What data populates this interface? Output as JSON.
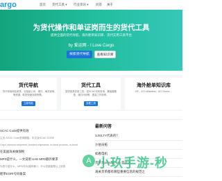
{
  "header": {
    "logo": "argo",
    "nav": [
      "首页",
      "货代工具 ▾",
      "行业资讯 ▾",
      "问答",
      "关于"
    ]
  },
  "hero": {
    "title": "为货代操作和单证岗而生的货代工具",
    "subtitle": "提供全面的货代导航、海外舱单知识库、货代实用工具平台",
    "by": "by 爱运网 - I Love Cargo",
    "primary_button": "探索货代导航",
    "secondary_button": "查看知识库"
  },
  "cards": [
    {
      "title": "货代导航",
      "desc": "货代常用网站收录，包括船公司、港口、海关官网等资源，助您快速找到所需。",
      "button": "立即导航"
    },
    {
      "title": "货代工具",
      "desc": "提供各类实用工具，如SCAC代码查询、集装箱箱型、港口代码等，提高工作效率。",
      "button": "查看工具"
    },
    {
      "title": "海外舱单知识库",
      "desc": "ISF，ACI eManifest，ACI Ocean ...",
      "button": ""
    }
  ],
  "sections": {
    "left_title": "",
    "right_title": "最新问答"
  },
  "left_list": [
    "SCAC Code提供有效",
    "主页-SCAC Code查询模板。中文及SCAC CODE",
    "Lloyd, inbound shipment, bonded shipments, in-bond process, in-bond",
    "在美国海关做保税",
    "MPD是什么，一文说明 UAE MPD额外要求",
    "为您介绍什么，MPD作为迪拜港口，什么您能接受以上信息",
    "舱单EORI号码备案"
  ],
  "right_list": [
    "3JS/LTY代表的？",
    "沙伯员拓",
    "如看电机",
    "货单为primary scn 是什么",
    "海关货单都有哪些重要信息的规范之"
  ],
  "watermark": {
    "text": "小玖手游-秒",
    "badge": "A"
  },
  "colors": {
    "hero_start": "#14a37d",
    "hero_end": "#36c7b8",
    "primary": "#1e73d8",
    "logo": "#1e9be0"
  }
}
